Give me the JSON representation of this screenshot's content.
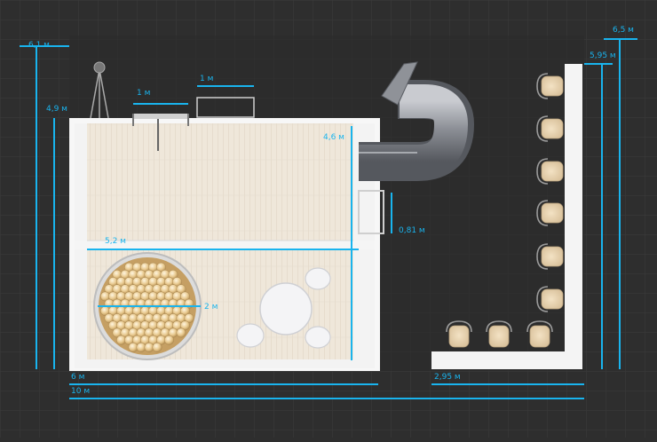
{
  "plan": {
    "colors": {
      "background": "#2e2e2e",
      "grid": "#3b3b3b",
      "dimension": "#19b4ee",
      "floor": "#efe8dc",
      "wall": "#f5f5f5"
    },
    "dimensions": {
      "left_outer_height": "6,1 м",
      "left_inner_height": "4,9 м",
      "top_left_rail": "1 м",
      "top_mid_rail": "1 м",
      "inner_vertical": "4,6 м",
      "step_height": "0,81 м",
      "inner_width": "5,2 м",
      "pit_diameter": "2 м",
      "bottom_width": "6 м",
      "total_width": "10 м",
      "counter_width": "2,95 м",
      "right_inner_height": "5,95 м",
      "right_outer_height": "6,5 м"
    },
    "objects": {
      "ball_pit": "ball-pit",
      "slide": "tube-slide",
      "stools_count": 9
    }
  }
}
